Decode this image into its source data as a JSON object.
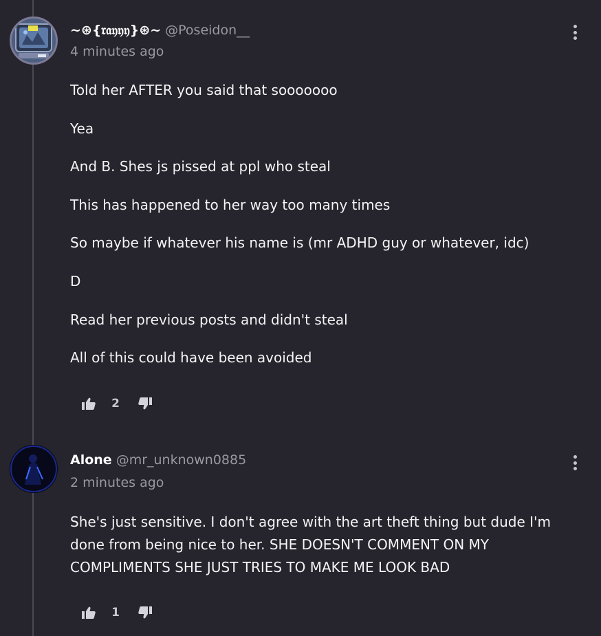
{
  "thread": {
    "comments": [
      {
        "display_name": "~⊛{𝔯𝔞𝔶𝔶𝔶}⊛~",
        "handle": "@Poseidon__",
        "timestamp": "4 minutes ago",
        "avatar_icon": "tv-avatar-icon",
        "paragraphs": [
          "Told her AFTER you said that sooooooo",
          "Yea",
          "And B. Shes js pissed at ppl who steal",
          "This has happened to her way too many times",
          "So maybe if whatever his name is (mr ADHD guy or whatever, idc)",
          "D",
          "Read her previous posts and didn't steal",
          "All of this could have been avoided"
        ],
        "upvotes": "2"
      },
      {
        "display_name": "Alone",
        "handle": "@mr_unknown0885",
        "timestamp": "2 minutes ago",
        "avatar_icon": "dark-figure-avatar-icon",
        "paragraphs": [
          "She's just sensitive. I don't agree with the art theft thing but dude I'm done from being nice to her. SHE DOESN'T COMMENT ON MY COMPLIMENTS SHE JUST TRIES TO MAKE ME LOOK BAD"
        ],
        "upvotes": "1"
      }
    ]
  },
  "icons": {
    "more": "more-vertical-icon",
    "upvote": "thumbs-up-icon",
    "downvote": "thumbs-down-icon"
  },
  "colors": {
    "background": "#26242c",
    "thread_line": "#4a4852",
    "muted_text": "#9a98a2",
    "primary_text": "#f4f4f6"
  }
}
